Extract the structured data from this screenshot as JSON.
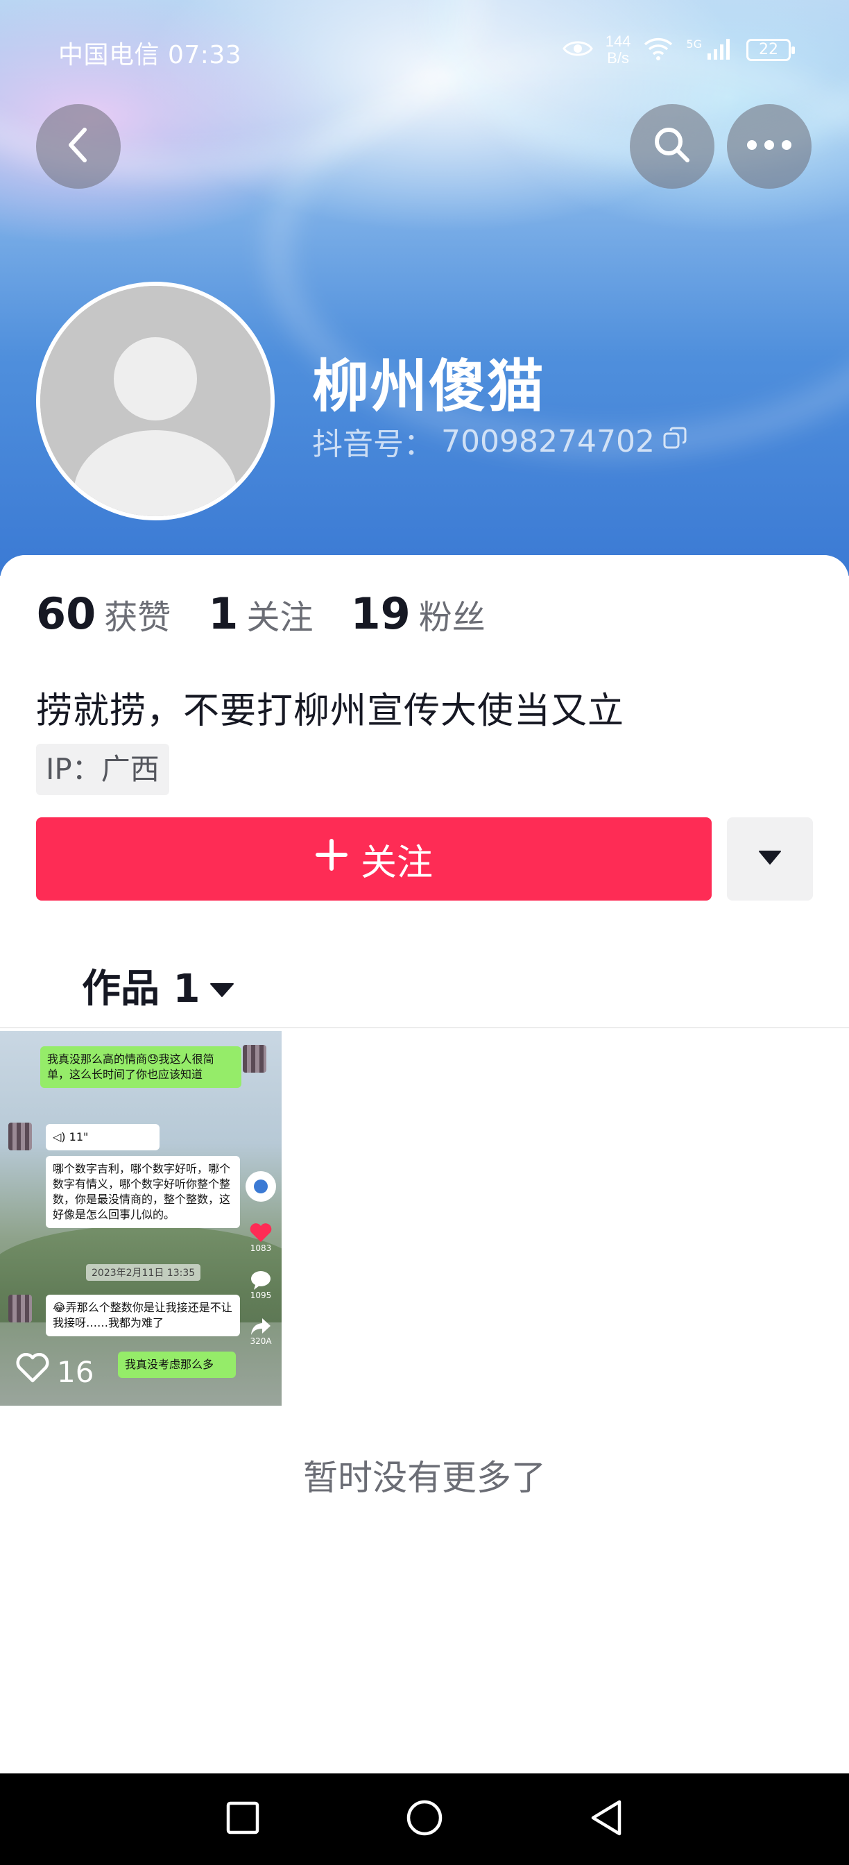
{
  "status_bar": {
    "carrier_time": "中国电信 07:33",
    "net_speed_value": "144",
    "net_speed_unit": "B/s",
    "network_type": "5G",
    "battery": "22"
  },
  "profile": {
    "nickname": "柳州傻猫",
    "douyin_id_label": "抖音号：",
    "douyin_id": "70098274702",
    "bio": "捞就捞，不要打柳州宣传大使当又立",
    "ip_location": "IP：广西"
  },
  "stats": {
    "likes_count": "60",
    "likes_label": "获赞",
    "following_count": "1",
    "following_label": "关注",
    "followers_count": "19",
    "followers_label": "粉丝"
  },
  "actions": {
    "follow_label": "关注"
  },
  "tabs": {
    "works_label": "作品 1"
  },
  "video": {
    "likes": "16",
    "chat": {
      "msg1": "我真没那么高的情商😓我这人很简单，这么长时间了你也应该知道",
      "voice": "11\"",
      "msg2": "哪个数字吉利，哪个数字好听，哪个数字有情义，哪个数字好听你整个整数，你是最没情商的，整个整数，这好像是怎么回事儿似的。",
      "time1": "2023年2月11日 13:35",
      "msg3": "😂弄那么个整数你是让我接还是不让我接呀……我都为难了",
      "msg4": "我真没考虑那么多",
      "side_like_count": "1083",
      "side_comment_count": "1095",
      "side_share_count": "320A"
    }
  },
  "footer": {
    "no_more": "暂时没有更多了"
  },
  "icons": {
    "back": "chevron-left-icon",
    "search": "search-icon",
    "more": "more-dots-icon",
    "copy": "copy-icon",
    "plus": "plus-icon",
    "caret": "caret-down-icon",
    "heart": "heart-outline-icon"
  },
  "colors": {
    "follow_button": "#fe2c55",
    "banner_blue": "#3b7ad4",
    "text_primary": "#161823",
    "text_secondary": "#6b6d75"
  }
}
